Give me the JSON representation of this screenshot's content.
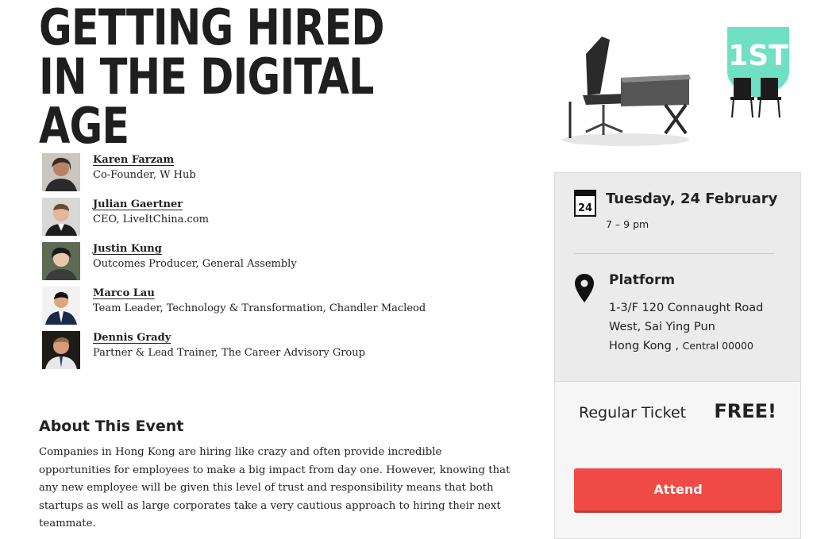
{
  "event": {
    "title": "Getting Hired in the Digital Age"
  },
  "speakers": [
    {
      "name": "Karen Farzam",
      "role": "Co-Founder, W Hub"
    },
    {
      "name": "Julian Gaertner",
      "role": "CEO, LiveItChina.com"
    },
    {
      "name": "Justin Kung",
      "role": "Outcomes Producer, General Assembly"
    },
    {
      "name": "Marco Lau",
      "role": "Team Leader, Technology & Transformation, Chandler Macleod"
    },
    {
      "name": "Dennis Grady",
      "role": "Partner & Lead Trainer, The Career Advisory Group"
    }
  ],
  "about": {
    "heading": "About This Event",
    "body": "Companies in Hong Kong are hiring like crazy and often provide incredible opportunities for employees to make a big impact from day one. However, knowing that any new employee will be given this level of trust and responsibility means that both startups as well as large corporates take a very cautious approach to hiring their next teammate."
  },
  "hero": {
    "badge": "1ST",
    "badge_color": "#6fe0c4"
  },
  "details": {
    "calendar_day": "24",
    "date": "Tuesday, 24 February",
    "time": "7 – 9 pm",
    "venue": "Platform",
    "address_line1": "1-3/F 120 Connaught Road",
    "address_line2": "West, Sai Ying Pun",
    "address_city": "Hong Kong",
    "address_region": "Central 00000"
  },
  "ticket": {
    "label": "Regular Ticket",
    "price": "FREE!",
    "button": "Attend",
    "button_color": "#f04a47"
  }
}
